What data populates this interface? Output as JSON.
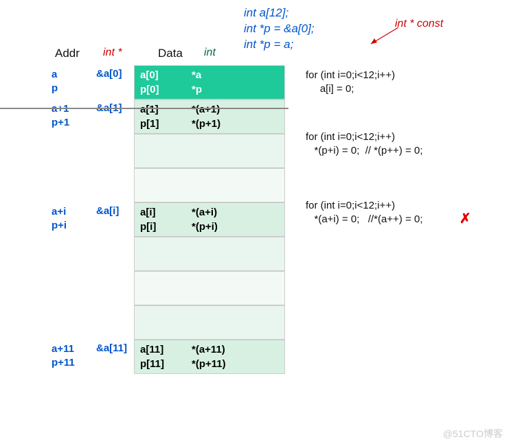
{
  "decl": {
    "l1": "int  a[12];",
    "l2": "int  *p = &a[0];",
    "l3": "   int  *p = a;",
    "const_label": "int  * const"
  },
  "headers": {
    "addr": "Addr",
    "intptr": "int *",
    "data": "Data",
    "int": "int"
  },
  "rows": [
    {
      "addr1": "a",
      "addr2": "p",
      "ptr": "&a[0]",
      "d1a": "a[0]",
      "d1b": "*a",
      "d2a": "p[0]",
      "d2b": "*p",
      "bg": "bg0"
    },
    {
      "addr1": "a+1",
      "addr2": "p+1",
      "ptr": "&a[1]",
      "d1a": "a[1]",
      "d1b": "*(a+1)",
      "d2a": "p[1]",
      "d2b": "*(p+1)",
      "bg": "bg1"
    },
    {
      "addr1": "",
      "addr2": "",
      "ptr": "",
      "d1a": "",
      "d1b": "",
      "d2a": "",
      "d2b": "",
      "bg": "bg2"
    },
    {
      "addr1": "",
      "addr2": "",
      "ptr": "",
      "d1a": "",
      "d1b": "",
      "d2a": "",
      "d2b": "",
      "bg": "bg3"
    },
    {
      "addr1": "a+i",
      "addr2": "p+i",
      "ptr": "&a[i]",
      "d1a": "a[i]",
      "d1b": "*(a+i)",
      "d2a": "p[i]",
      "d2b": "*(p+i)",
      "bg": "bg1"
    },
    {
      "addr1": "",
      "addr2": "",
      "ptr": "",
      "d1a": "",
      "d1b": "",
      "d2a": "",
      "d2b": "",
      "bg": "bg2"
    },
    {
      "addr1": "",
      "addr2": "",
      "ptr": "",
      "d1a": "",
      "d1b": "",
      "d2a": "",
      "d2b": "",
      "bg": "bg3"
    },
    {
      "addr1": "",
      "addr2": "",
      "ptr": "",
      "d1a": "",
      "d1b": "",
      "d2a": "",
      "d2b": "",
      "bg": "bg2"
    },
    {
      "addr1": "a+11",
      "addr2": "p+11",
      "ptr": "&a[11]",
      "d1a": "a[11]",
      "d1b": "*(a+11)",
      "d2a": "p[11]",
      "d2b": "*(p+11)",
      "bg": "bg1"
    }
  ],
  "codeblocks": {
    "c1": "for (int i=0;i<12;i++)\n     a[i] = 0;",
    "c2": "for (int i=0;i<12;i++)\n   *(p+i) = 0;  // *(p++) = 0;",
    "c3": "for (int i=0;i<12;i++)\n   *(a+i) = 0;   //*(a++) = 0;"
  },
  "watermark": "@51CTO博客"
}
